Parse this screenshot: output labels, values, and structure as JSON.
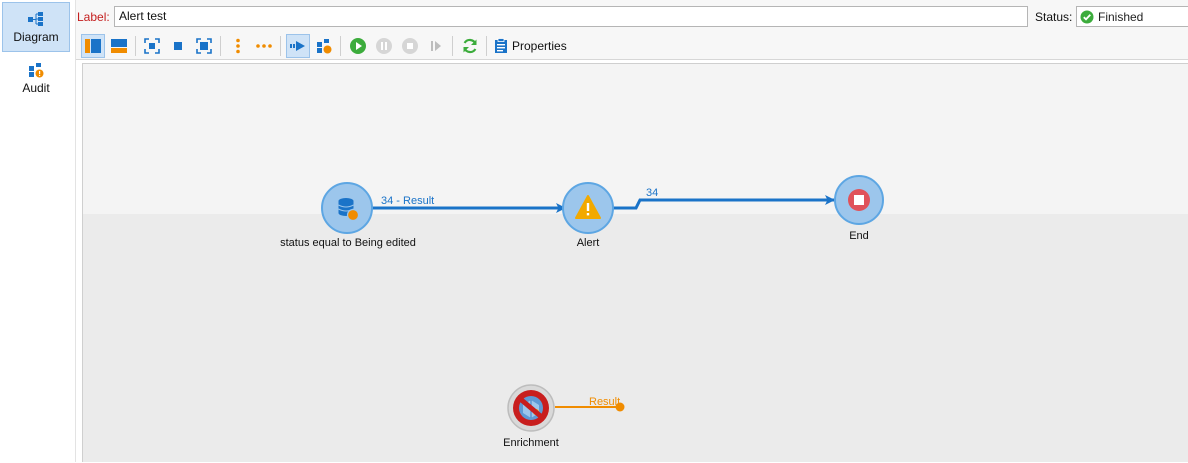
{
  "nav": {
    "items": [
      {
        "label": "Diagram",
        "icon": "diagram-icon",
        "active": true
      },
      {
        "label": "Audit",
        "icon": "audit-icon",
        "active": false
      }
    ]
  },
  "header": {
    "label_caption": "Label:",
    "label_value": "Alert test",
    "status_caption": "Status:",
    "status_value": "Finished",
    "status_icon": "check-circle-icon"
  },
  "toolbar": {
    "properties_label": "Properties",
    "icons": [
      "layout-vertical-icon",
      "layout-horizontal-icon",
      "fit-to-view-icon",
      "actual-size-icon",
      "zoom-fit-icon",
      "align-vertical-icon",
      "align-horizontal-icon",
      "auto-link-icon",
      "audit-mode-icon",
      "start-icon",
      "pause-icon",
      "stop-icon",
      "step-icon",
      "refresh-icon",
      "properties-icon"
    ]
  },
  "diagram": {
    "nodes": [
      {
        "label": "status equal to Being edited",
        "icon": "query-icon"
      },
      {
        "label": "Alert",
        "icon": "alert-icon"
      },
      {
        "label": "End",
        "icon": "end-icon"
      },
      {
        "label": "Enrichment",
        "icon": "enrichment-disabled-icon"
      }
    ],
    "links": [
      {
        "label": "34 - Result",
        "color": "#1a73c8"
      },
      {
        "label": "34",
        "color": "#1a73c8"
      },
      {
        "label": "Result",
        "color": "#f08c00"
      }
    ]
  },
  "colors": {
    "accent": "#1a73c8",
    "node_fill": "#9cc6ec",
    "warning": "#f2a900",
    "end_red": "#e0525a",
    "orange": "#f08c00",
    "success": "#3cac3c"
  }
}
